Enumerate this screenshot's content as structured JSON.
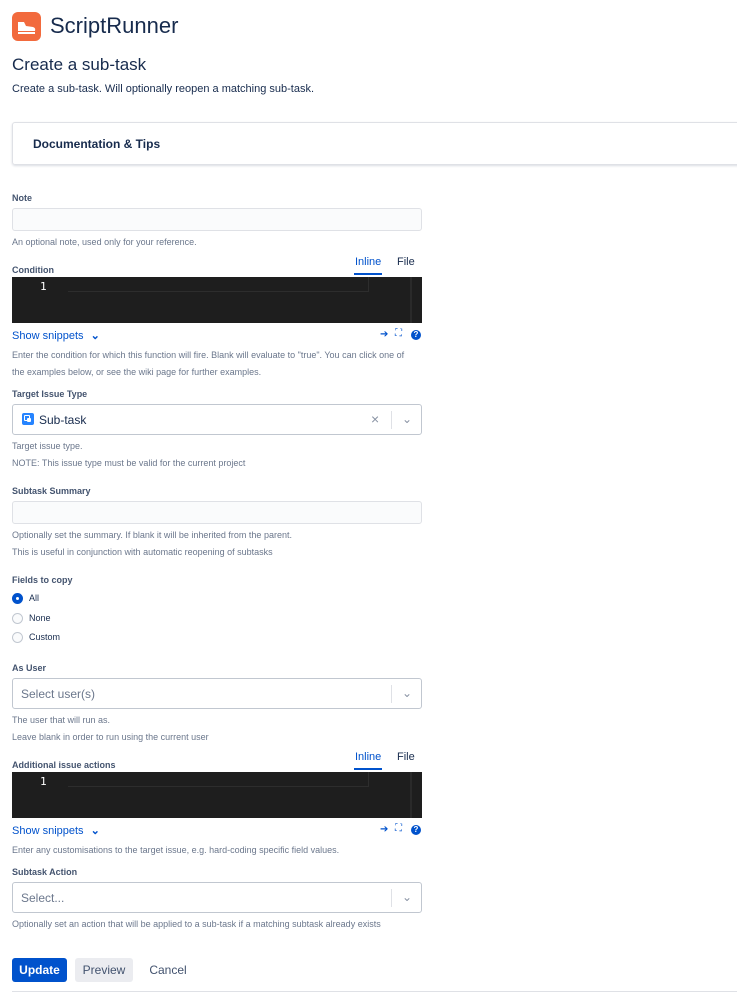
{
  "header": {
    "app_name": "ScriptRunner",
    "logo_icon": "scriptrunner-shoe-logo",
    "brand_color": "#f26a3d"
  },
  "page": {
    "title": "Create a sub-task",
    "description": "Create a sub-task. Will optionally reopen a matching sub-task."
  },
  "docs_panel": {
    "label": "Documentation & Tips"
  },
  "note": {
    "label": "Note",
    "value": "",
    "help": "An optional note, used only for your reference."
  },
  "condition": {
    "label": "Condition",
    "tabs": [
      "Inline",
      "File"
    ],
    "active_tab": "Inline",
    "line_number": "1",
    "show_snippets": "Show snippets",
    "help_line1": "Enter the condition for which this function will fire. Blank will evaluate to \"true\". You can click one of",
    "help_line2": "the examples below, or see the wiki page for further examples."
  },
  "target_issue_type": {
    "label": "Target Issue Type",
    "value": "Sub-task",
    "help_line1": "Target issue type.",
    "help_line2": "NOTE: This issue type must be valid for the current project"
  },
  "subtask_summary": {
    "label": "Subtask Summary",
    "value": "",
    "help_line1": "Optionally set the summary. If blank it will be inherited from the parent.",
    "help_line2": "This is useful in conjunction with automatic reopening of subtasks"
  },
  "fields_to_copy": {
    "label": "Fields to copy",
    "options": [
      "All",
      "None",
      "Custom"
    ],
    "selected": "All"
  },
  "as_user": {
    "label": "As User",
    "placeholder": "Select user(s)",
    "help_line1": "The user that will run as.",
    "help_line2": "Leave blank in order to run using the current user"
  },
  "additional_actions": {
    "label": "Additional issue actions",
    "tabs": [
      "Inline",
      "File"
    ],
    "active_tab": "Inline",
    "line_number": "1",
    "show_snippets": "Show snippets",
    "help": "Enter any customisations to the target issue, e.g. hard-coding specific field values."
  },
  "subtask_action": {
    "label": "Subtask Action",
    "placeholder": "Select...",
    "help": "Optionally set an action that will be applied to a sub-task if a matching subtask already exists"
  },
  "buttons": {
    "update": "Update",
    "preview": "Preview",
    "cancel": "Cancel"
  },
  "colors": {
    "primary": "#0052cc",
    "editor_bg": "#1e1e1e"
  }
}
